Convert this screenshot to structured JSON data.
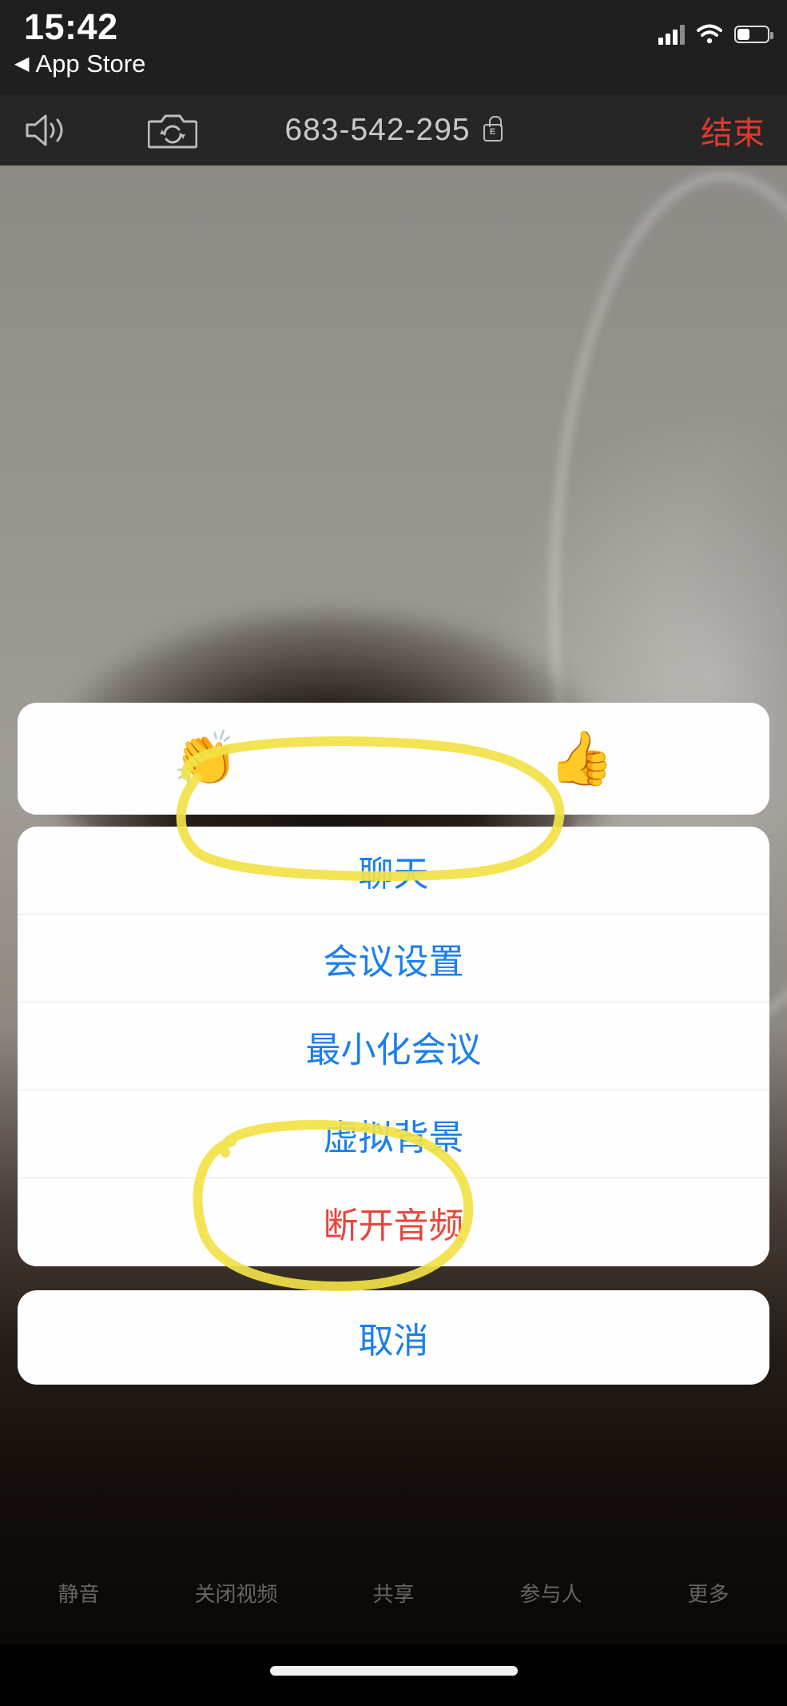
{
  "status_bar": {
    "time": "15:42",
    "back_label": "App Store",
    "back_arrow": "◀",
    "signal_icon": "cellular-signal-icon",
    "wifi_icon": "wifi-icon",
    "battery_icon": "battery-icon"
  },
  "nav_bar": {
    "speaker_icon": "speaker-icon",
    "switch_camera_icon": "switch-camera-icon",
    "meeting_id": "683-542-295",
    "lock_icon": "lock-encrypted-icon",
    "lock_letter": "E",
    "end_label": "结束"
  },
  "reactions": {
    "items": [
      {
        "emoji": "👏",
        "name": "clapping-hands-reaction"
      },
      {
        "emoji": "👍",
        "name": "thumbs-up-reaction"
      }
    ]
  },
  "action_sheet": {
    "items": [
      {
        "label": "聊天",
        "style": "default",
        "name": "chat"
      },
      {
        "label": "会议设置",
        "style": "default",
        "name": "meeting-settings"
      },
      {
        "label": "最小化会议",
        "style": "default",
        "name": "minimize-meeting"
      },
      {
        "label": "虚拟背景",
        "style": "default",
        "name": "virtual-background"
      },
      {
        "label": "断开音频",
        "style": "destructive",
        "name": "disconnect-audio"
      }
    ],
    "cancel_label": "取消"
  },
  "bottom_toolbar": {
    "items": [
      {
        "label": "静音",
        "name": "mute"
      },
      {
        "label": "关闭视频",
        "name": "stop-video"
      },
      {
        "label": "共享",
        "name": "share"
      },
      {
        "label": "参与人",
        "name": "participants"
      },
      {
        "label": "更多",
        "name": "more"
      }
    ]
  },
  "annotations": [
    {
      "name": "highlight-reactions",
      "shape": "hand-drawn-ellipse",
      "color": "#f5e74a"
    },
    {
      "name": "highlight-virtual-background",
      "shape": "hand-drawn-ellipse",
      "color": "#f5e74a"
    }
  ],
  "colors": {
    "status_bar_bg": "#1f1f1f",
    "nav_bar_bg": "#262626",
    "end_red": "#e03a30",
    "action_blue": "#1a7ff0",
    "destructive_red": "#e8453c",
    "sheet_bg": "#fefefe",
    "annotation_yellow": "#f5e74a"
  }
}
